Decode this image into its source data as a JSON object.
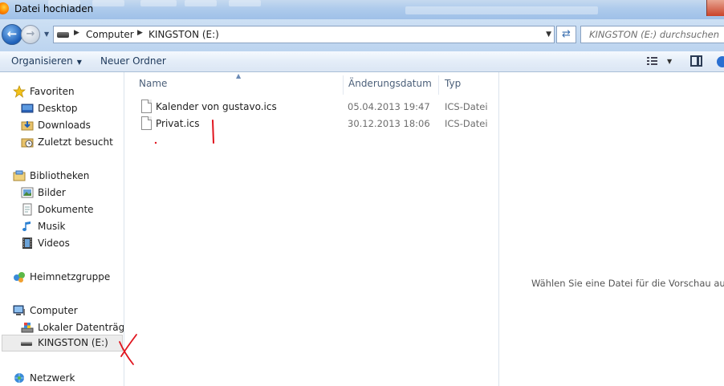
{
  "window": {
    "title": "Datei hochladen"
  },
  "address_bar": {
    "breadcrumbs": [
      "Computer",
      "KINGSTON (E:)"
    ],
    "search_placeholder": "KINGSTON (E:) durchsuchen"
  },
  "toolbar": {
    "organize_label": "Organisieren",
    "new_folder_label": "Neuer Ordner"
  },
  "nav": {
    "favorites": {
      "label": "Favoriten",
      "items": [
        "Desktop",
        "Downloads",
        "Zuletzt besucht"
      ]
    },
    "libraries": {
      "label": "Bibliotheken",
      "items": [
        "Bilder",
        "Dokumente",
        "Musik",
        "Videos"
      ]
    },
    "homegroup": {
      "label": "Heimnetzgruppe"
    },
    "computer": {
      "label": "Computer",
      "items": [
        "Lokaler Datenträger",
        "KINGSTON (E:)"
      ],
      "selected": "KINGSTON (E:)"
    },
    "network": {
      "label": "Netzwerk"
    }
  },
  "columns": {
    "name": "Name",
    "date": "Änderungsdatum",
    "type": "Typ"
  },
  "files": [
    {
      "name": "Kalender von gustavo.ics",
      "date": "05.04.2013 19:47",
      "type": "ICS-Datei"
    },
    {
      "name": "Privat.ics",
      "date": "30.12.2013 18:06",
      "type": "ICS-Datei"
    }
  ],
  "preview": {
    "message": "Wählen Sie eine Datei für die Vorschau aus."
  },
  "colors": {
    "titlebar": "#aecbec",
    "command_bar": "#e4edf8",
    "annotation_red": "#e0141e",
    "selected_bg": "#ececec"
  },
  "icons": {
    "back": "back-arrow-icon",
    "forward": "forward-arrow-icon",
    "refresh": "refresh-icon",
    "view": "view-options-icon",
    "preview_pane": "preview-pane-icon",
    "help": "help-icon"
  }
}
